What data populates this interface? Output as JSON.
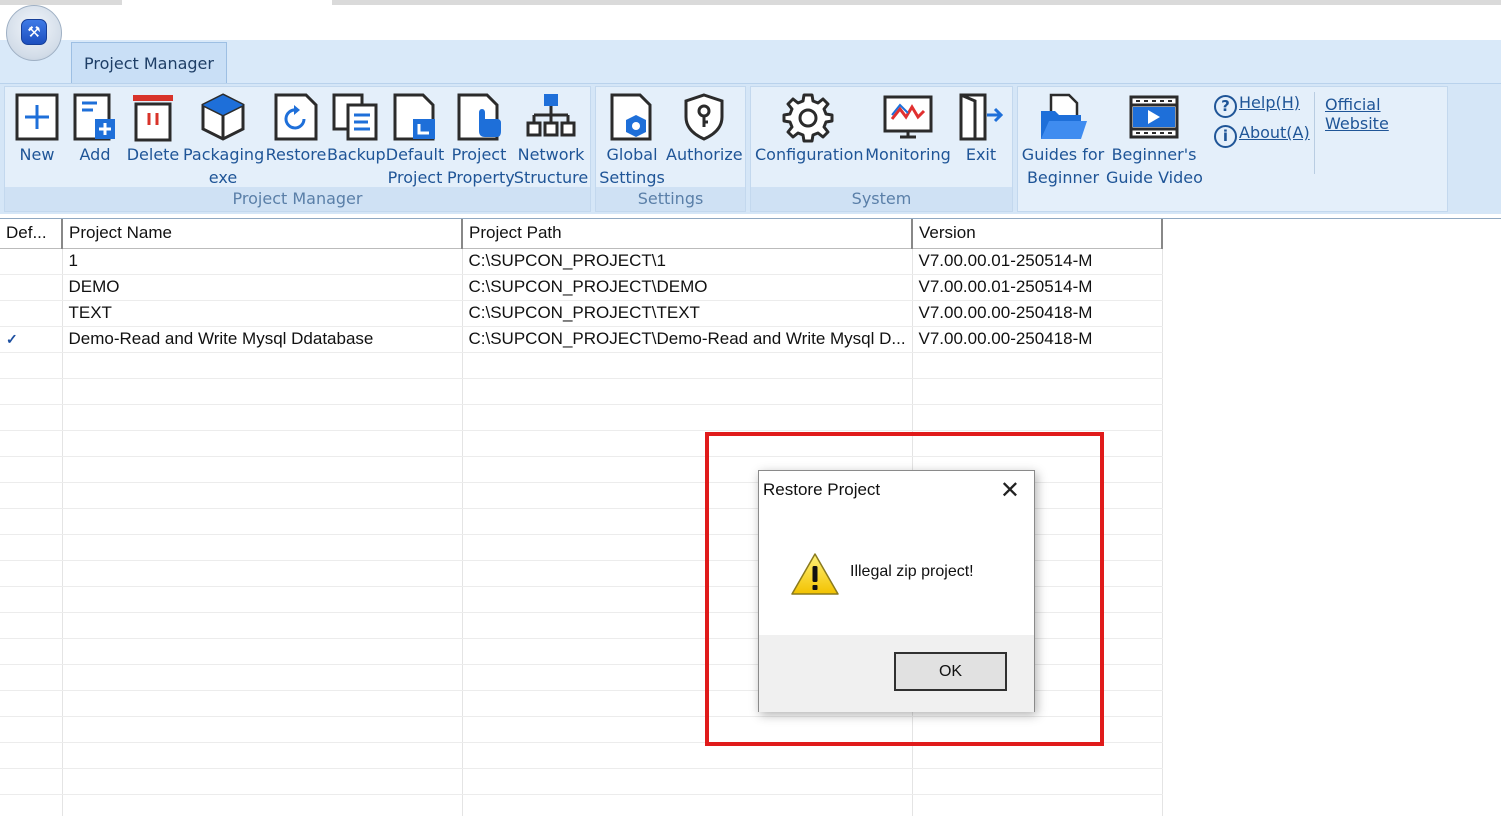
{
  "app": {
    "orb_icon": "tools-icon"
  },
  "ribbon": {
    "active_tab": "Project Manager",
    "groups": {
      "project_manager": {
        "label": "Project Manager",
        "buttons": [
          {
            "line1": "New",
            "line2": "",
            "icon": "new-icon"
          },
          {
            "line1": "Add",
            "line2": "",
            "icon": "add-icon"
          },
          {
            "line1": "Delete",
            "line2": "",
            "icon": "delete-icon"
          },
          {
            "line1": "Packaging",
            "line2": "exe",
            "icon": "packaging-icon"
          },
          {
            "line1": "Restore",
            "line2": "",
            "icon": "restore-icon"
          },
          {
            "line1": "Backup",
            "line2": "",
            "icon": "backup-icon"
          },
          {
            "line1": "Default",
            "line2": "Project",
            "icon": "default-project-icon"
          },
          {
            "line1": "Project",
            "line2": "Property",
            "icon": "project-property-icon"
          },
          {
            "line1": "Network",
            "line2": "Structure",
            "icon": "network-structure-icon"
          }
        ]
      },
      "settings": {
        "label": "Settings",
        "buttons": [
          {
            "line1": "Global",
            "line2": "Settings",
            "icon": "global-settings-icon"
          },
          {
            "line1": "Authorize",
            "line2": "",
            "icon": "authorize-icon"
          }
        ]
      },
      "system": {
        "label": "System",
        "buttons": [
          {
            "line1": "Configuration",
            "line2": "",
            "icon": "configuration-icon"
          },
          {
            "line1": "Monitoring",
            "line2": "",
            "icon": "monitoring-icon"
          },
          {
            "line1": "Exit",
            "line2": "",
            "icon": "exit-icon"
          }
        ]
      },
      "guides": {
        "label": "",
        "buttons": [
          {
            "line1": "Guides for",
            "line2": "Beginner",
            "icon": "guide-folder-icon"
          },
          {
            "line1": "Beginner's",
            "line2": "Guide Video",
            "icon": "video-icon"
          }
        ],
        "links": {
          "help": "Help(H)",
          "about": "About(A)",
          "website": "Official Website"
        }
      }
    }
  },
  "table": {
    "columns": [
      "Def...",
      "Project Name",
      "Project Path",
      "Version"
    ],
    "rows": [
      {
        "default": "",
        "name": "1",
        "path": "C:\\SUPCON_PROJECT\\1",
        "version": "V7.00.00.01-250514-M"
      },
      {
        "default": "",
        "name": "DEMO",
        "path": "C:\\SUPCON_PROJECT\\DEMO",
        "version": "V7.00.00.01-250514-M"
      },
      {
        "default": "",
        "name": "TEXT",
        "path": "C:\\SUPCON_PROJECT\\TEXT",
        "version": "V7.00.00.00-250418-M"
      },
      {
        "default": "✓",
        "name": "Demo-Read and Write Mysql Ddatabase",
        "path": "C:\\SUPCON_PROJECT\\Demo-Read and Write Mysql D...",
        "version": "V7.00.00.00-250418-M"
      }
    ]
  },
  "dialog": {
    "title": "Restore Project",
    "message": "Illegal zip project!",
    "ok_label": "OK",
    "icon": "warning-icon"
  },
  "colors": {
    "accent": "#1f5597",
    "highlight": "#e01b1b",
    "ribbon": "#d5e6f7"
  }
}
